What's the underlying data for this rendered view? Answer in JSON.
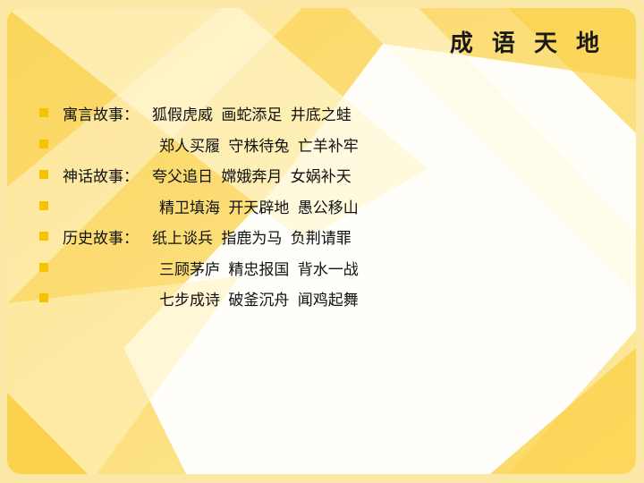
{
  "slide": {
    "title": "成 语 天 地",
    "colors": {
      "accent": "#f5c400",
      "background_light": "#fde48a",
      "highlight": "#ffffff",
      "text": "#111111"
    },
    "rows": [
      {
        "category": "寓言故事：",
        "idioms": "狐假虎威  画蛇添足 井底之蛙"
      },
      {
        "category": "",
        "idioms": "郑人买履  守株待兔 亡羊补牢"
      },
      {
        "category": "神话故事：",
        "idioms": "夸父追日  嫦娥奔月 女娲补天"
      },
      {
        "category": "",
        "idioms": "精卫填海  开天辟地 愚公移山"
      },
      {
        "category": "历史故事：",
        "idioms": "纸上谈兵  指鹿为马 负荆请罪"
      },
      {
        "category": "",
        "idioms": "三顾茅庐  精忠报国 背水一战"
      },
      {
        "category": "",
        "idioms": "七步成诗  破釜沉舟 闻鸡起舞"
      }
    ]
  }
}
